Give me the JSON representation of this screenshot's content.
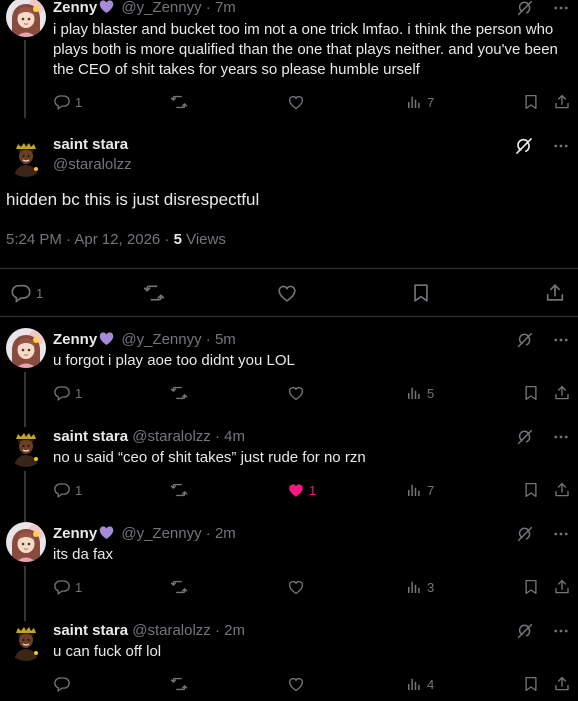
{
  "tweets": [
    {
      "name": "Zenny",
      "handle": "@y_Zennyy",
      "time": "7m",
      "text": "i play blaster and bucket too im not a one trick lmfao. i think the person who plays both is more qualified than the one that plays neither. and you've been the CEO of shit takes for years so please humble urself",
      "replies": "1",
      "likes": "",
      "views": "7"
    },
    {
      "name": "Zenny",
      "handle": "@y_Zennyy",
      "time": "5m",
      "text": "u forgot i play aoe too didnt you LOL",
      "replies": "1",
      "likes": "",
      "views": "5"
    },
    {
      "name": "saint stara",
      "handle": "@staralolzz",
      "time": "4m",
      "text": "no u said “ceo of shit takes” just rude for no rzn",
      "replies": "1",
      "likes": "1",
      "views": "7"
    },
    {
      "name": "Zenny",
      "handle": "@y_Zennyy",
      "time": "2m",
      "text": "its da fax",
      "replies": "1",
      "likes": "",
      "views": "3"
    },
    {
      "name": "saint stara",
      "handle": "@staralolzz",
      "time": "2m",
      "text": "u can fuck off lol",
      "replies": "",
      "likes": "",
      "views": "4"
    }
  ],
  "main": {
    "name": "saint stara",
    "handle": "@staralolzz",
    "text": "hidden bc this is just disrespectful",
    "timestamp": "5:24 PM · Apr 12, 2026 · ",
    "views_count": "5",
    "views_label": " Views",
    "replies": "1"
  },
  "colors": {
    "background": "#000000",
    "text": "#e7e9ea",
    "muted": "#71767b",
    "divider": "#2f3336",
    "like": "#f91880",
    "badge": "#a78bdb"
  },
  "icons": [
    "reply-icon",
    "repost-icon",
    "like-icon",
    "views-icon",
    "bookmark-icon",
    "share-icon",
    "grok-icon",
    "more-icon",
    "purple-heart-icon"
  ]
}
